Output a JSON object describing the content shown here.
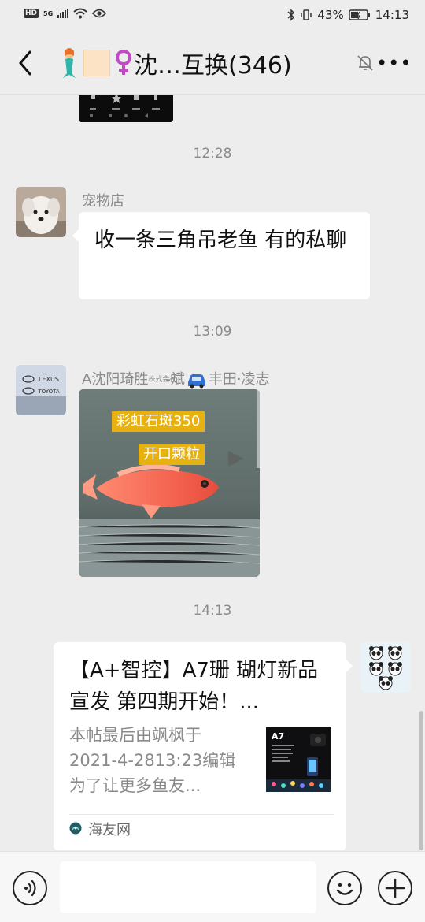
{
  "status_bar": {
    "hd": "HD",
    "network": "5G",
    "battery_percent": "43%",
    "time": "14:13"
  },
  "header": {
    "title": "沈…互换(346)",
    "icons": [
      "back-arrow-icon",
      "mermaid-emoji-icon",
      "orange-square-icon",
      "female-symbol-icon",
      "mute-bell-icon",
      "more-icon"
    ]
  },
  "messages": [
    {
      "type": "time",
      "text": "12:28"
    },
    {
      "type": "text",
      "sender": "宠物店",
      "text": "收一条三角吊老鱼 有的私聊"
    },
    {
      "type": "time",
      "text": "13:09"
    },
    {
      "type": "image",
      "sender_prefix": "A沈阳琦胜",
      "sender_mark": "株式会社",
      "sender_mid": "-斌",
      "sender_suffix": "丰田·凌志",
      "tag1": "彩虹石斑350",
      "tag2": "开口颗粒"
    },
    {
      "type": "time",
      "text": "14:13"
    },
    {
      "type": "link_card",
      "title": "【A+智控】A7珊 瑚灯新品宣发  第四期开始！...",
      "desc": "本帖最后由飒枫于2021-4-2813:23编辑为了让更多鱼友...",
      "thumb_label": "A7",
      "source": "海友网"
    }
  ],
  "avatar_labels": {
    "lexus": "LEXUS",
    "toyota": "TOYOTA"
  },
  "input_bar": {
    "value": "",
    "icons": [
      "voice-icon",
      "emoji-icon",
      "plus-icon"
    ]
  },
  "colors": {
    "background": "#ededed",
    "bubble": "#ffffff",
    "fish_tag": "#e7b10f",
    "time_text": "#8a8a8a"
  }
}
